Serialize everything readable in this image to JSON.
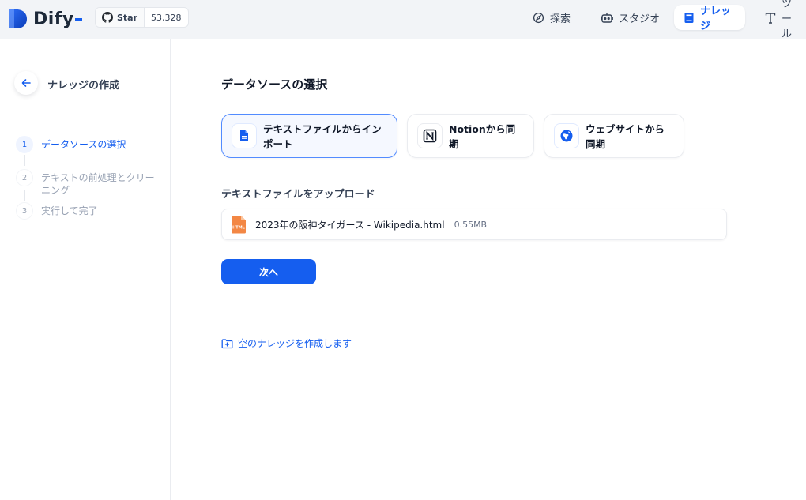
{
  "header": {
    "logo_text": "Dify",
    "github": {
      "star_label": "Star",
      "star_count": "53,328"
    },
    "nav": [
      {
        "label": "探索",
        "icon": "compass-icon"
      },
      {
        "label": "スタジオ",
        "icon": "robot-icon"
      },
      {
        "label": "ナレッジ",
        "icon": "book-icon",
        "active": true
      },
      {
        "label": "ツール",
        "icon": "tools-icon"
      }
    ]
  },
  "sidebar": {
    "title": "ナレッジの作成",
    "steps": [
      {
        "num": "1",
        "label": "データソースの選択",
        "active": true
      },
      {
        "num": "2",
        "label": "テキストの前処理とクリーニング"
      },
      {
        "num": "3",
        "label": "実行して完了"
      }
    ]
  },
  "main": {
    "heading": "データソースの選択",
    "sources": [
      {
        "label": "テキストファイルからインポート",
        "icon": "document-icon",
        "active": true
      },
      {
        "label": "Notionから同期",
        "icon": "notion-icon"
      },
      {
        "label": "ウェブサイトから同期",
        "icon": "website-icon"
      }
    ],
    "upload_heading": "テキストファイルをアップロード",
    "file": {
      "name": "2023年の阪神タイガース - Wikipedia.html",
      "size": "0.55MB",
      "type_badge": "HTML"
    },
    "next_label": "次へ",
    "empty_link": "空のナレッジを作成します"
  },
  "colors": {
    "accent": "#155eef",
    "file_badge": "#f38744"
  }
}
